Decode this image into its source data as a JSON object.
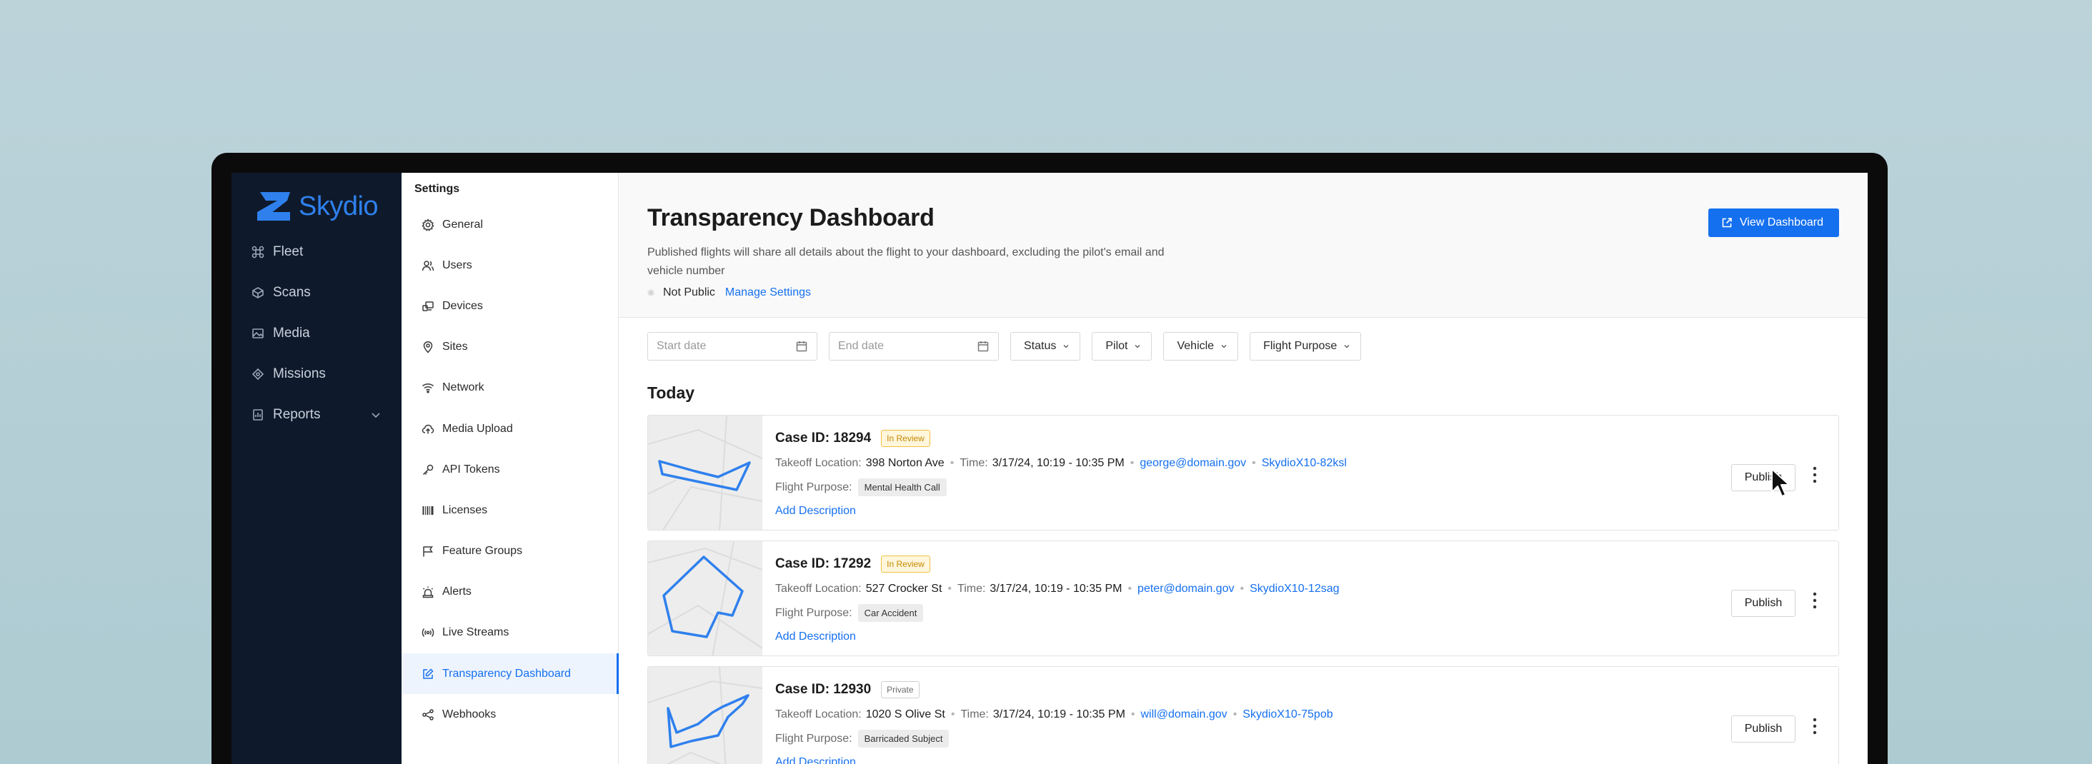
{
  "brand": {
    "name": "Skydio",
    "accent": "#1570ef",
    "nav_bg": "#0e1a2b"
  },
  "nav": {
    "items": [
      {
        "label": "Fleet",
        "icon": "fleet-icon"
      },
      {
        "label": "Scans",
        "icon": "scans-icon"
      },
      {
        "label": "Media",
        "icon": "media-icon"
      },
      {
        "label": "Missions",
        "icon": "missions-icon"
      },
      {
        "label": "Reports",
        "icon": "reports-icon"
      }
    ]
  },
  "settings": {
    "title": "Settings",
    "items": [
      {
        "label": "General",
        "icon": "gear-icon"
      },
      {
        "label": "Users",
        "icon": "users-icon"
      },
      {
        "label": "Devices",
        "icon": "devices-icon"
      },
      {
        "label": "Sites",
        "icon": "location-pin-icon"
      },
      {
        "label": "Network",
        "icon": "wifi-icon"
      },
      {
        "label": "Media Upload",
        "icon": "cloud-upload-icon"
      },
      {
        "label": "API Tokens",
        "icon": "key-icon"
      },
      {
        "label": "Licenses",
        "icon": "barcode-icon"
      },
      {
        "label": "Feature Groups",
        "icon": "flag-icon"
      },
      {
        "label": "Alerts",
        "icon": "siren-icon"
      },
      {
        "label": "Live Streams",
        "icon": "broadcast-icon"
      },
      {
        "label": "Transparency Dashboard",
        "icon": "edit-icon",
        "active": true
      },
      {
        "label": "Webhooks",
        "icon": "share-icon"
      }
    ]
  },
  "header": {
    "title": "Transparency Dashboard",
    "description": "Published flights will share all details about the flight to your dashboard, excluding the pilot's email and vehicle number",
    "status": "Not Public",
    "manage_link": "Manage Settings",
    "view_button": "View Dashboard"
  },
  "filters": {
    "start_date_placeholder": "Start date",
    "end_date_placeholder": "End date",
    "dropdowns": [
      "Status",
      "Pilot",
      "Vehicle",
      "Flight Purpose"
    ]
  },
  "section_title": "Today",
  "labels": {
    "takeoff": "Takeoff Location:",
    "time": "Time:",
    "purpose": "Flight Purpose:",
    "add_description": "Add Description",
    "publish": "Publish"
  },
  "cases": [
    {
      "case_id": "Case ID: 18294",
      "badge": "In Review",
      "badge_type": "review",
      "takeoff": "398 Norton Ave",
      "time": "3/17/24, 10:19 - 10:35 PM",
      "email": "george@domain.gov",
      "vehicle": "SkydioX10-82ksl",
      "purpose": "Mental Health Call"
    },
    {
      "case_id": "Case ID: 17292",
      "badge": "In Review",
      "badge_type": "review",
      "takeoff": "527 Crocker St",
      "time": "3/17/24, 10:19 - 10:35 PM",
      "email": "peter@domain.gov",
      "vehicle": "SkydioX10-12sag",
      "purpose": "Car Accident"
    },
    {
      "case_id": "Case ID: 12930",
      "badge": "Private",
      "badge_type": "private",
      "takeoff": "1020 S Olive St",
      "time": "3/17/24, 10:19 - 10:35 PM",
      "email": "will@domain.gov",
      "vehicle": "SkydioX10-75pob",
      "purpose": "Barricaded Subject"
    }
  ]
}
